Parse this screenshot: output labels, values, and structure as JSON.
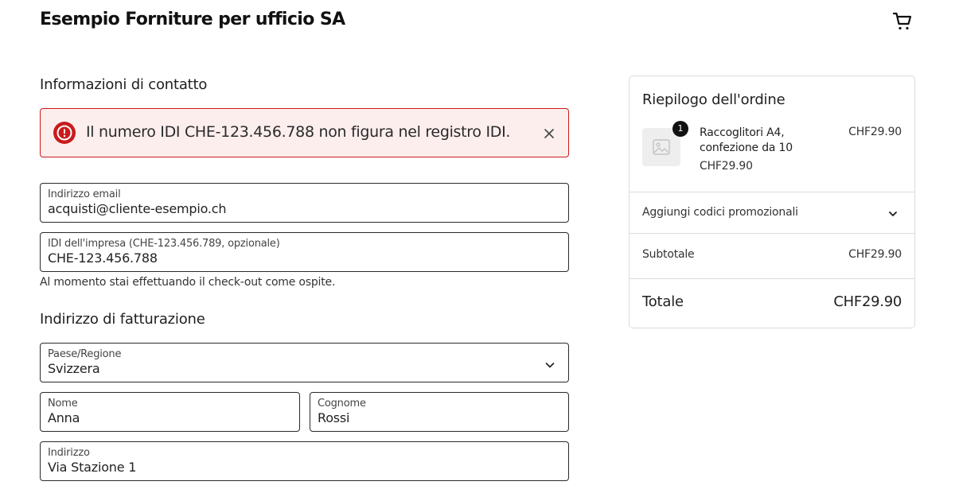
{
  "header": {
    "store_name": "Esempio Forniture per ufficio SA",
    "cart_icon": "cart-icon"
  },
  "contact": {
    "title": "Informazioni di contatto",
    "error": {
      "icon": "alert-circle-icon",
      "message": "Il numero IDI CHE-123.456.788 non figura nel registro IDI.",
      "close_icon": "close-icon"
    },
    "email": {
      "label": "Indirizzo email",
      "value": "acquisti@cliente-esempio.ch"
    },
    "uid": {
      "label": "IDI dell'impresa (CHE-123.456.789, opzionale)",
      "value": "CHE-123.456.788"
    },
    "guest_note": "Al momento stai effettuando il check-out come ospite."
  },
  "billing": {
    "title": "Indirizzo di fatturazione",
    "country": {
      "label": "Paese/Regione",
      "value": "Svizzera"
    },
    "first_name": {
      "label": "Nome",
      "value": "Anna"
    },
    "last_name": {
      "label": "Cognome",
      "value": "Rossi"
    },
    "address": {
      "label": "Indirizzo",
      "value": "Via Stazione 1"
    }
  },
  "summary": {
    "title": "Riepilogo dell'ordine",
    "item": {
      "quantity": "1",
      "name": "Raccoglitori A4, confezione da 10",
      "unit_price": "CHF29.90",
      "line_price": "CHF29.90"
    },
    "promo_label": "Aggiungi codici promozionali",
    "subtotal_label": "Subtotale",
    "subtotal_value": "CHF29.90",
    "total_label": "Totale",
    "total_value": "CHF29.90"
  },
  "colors": {
    "error_border": "#c91b1b",
    "error_bg": "#fdeeee",
    "text": "#1a1a1a"
  }
}
